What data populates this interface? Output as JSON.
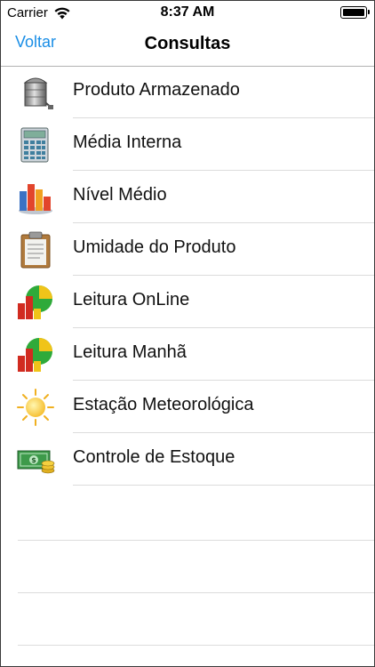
{
  "status_bar": {
    "carrier": "Carrier",
    "time": "8:37 AM",
    "battery_level": 1.0,
    "wifi_icon": "wifi-icon"
  },
  "nav": {
    "back_label": "Voltar",
    "title": "Consultas"
  },
  "menu": {
    "items": [
      {
        "label": "Produto Armazenado",
        "icon": "silo-icon"
      },
      {
        "label": "Média Interna",
        "icon": "calculator-icon"
      },
      {
        "label": "Nível Médio",
        "icon": "bar-chart-icon"
      },
      {
        "label": "Umidade do Produto",
        "icon": "clipboard-icon"
      },
      {
        "label": "Leitura OnLine",
        "icon": "chart-pie-icon"
      },
      {
        "label": "Leitura Manhã",
        "icon": "chart-pie-icon"
      },
      {
        "label": "Estação Meteorológica",
        "icon": "sun-icon"
      },
      {
        "label": "Controle de Estoque",
        "icon": "money-icon"
      }
    ]
  },
  "colors": {
    "accent": "#1a8ee6",
    "separator": "#dcdcdc"
  }
}
